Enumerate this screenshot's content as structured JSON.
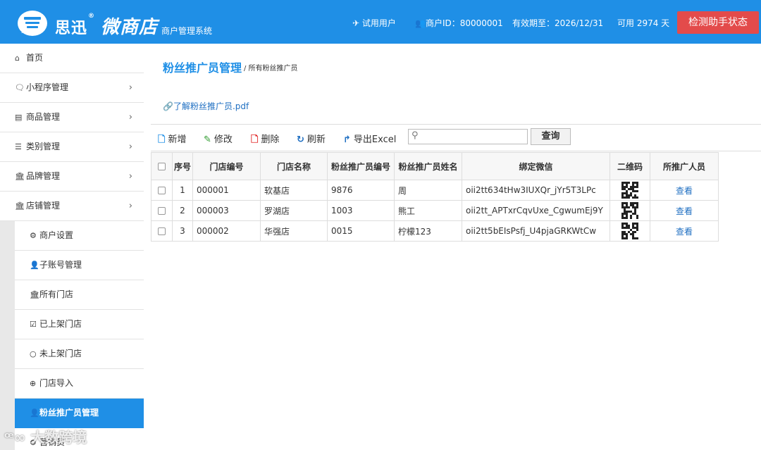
{
  "header": {
    "brand": "思迅",
    "brand_reg": "®",
    "brand2": "微商店",
    "subsystem": "商户管理系统",
    "user_type": "试用用户",
    "merchant_id": "商户ID：80000001",
    "expiry": "有效期至：2026/12/31",
    "available": "可用 2974 天",
    "detect_button": "检测助手状态",
    "accent": "#1f8fe6",
    "detect_color": "#e34b4b"
  },
  "sidebar": {
    "items": [
      {
        "label": "首页",
        "icon": "home-icon",
        "chevron": ""
      },
      {
        "label": "小程序管理",
        "icon": "chat-icon",
        "chevron": "›"
      },
      {
        "label": "商品管理",
        "icon": "card-icon",
        "chevron": "›"
      },
      {
        "label": "类别管理",
        "icon": "list-icon",
        "chevron": "›"
      },
      {
        "label": "品牌管理",
        "icon": "bank-icon",
        "chevron": "›"
      },
      {
        "label": "店铺管理",
        "icon": "bank-icon",
        "chevron": "›"
      }
    ],
    "sub_items": [
      {
        "label": "商户设置",
        "icon": "gear-icon"
      },
      {
        "label": "子账号管理",
        "icon": "user-icon"
      },
      {
        "label": "所有门店",
        "icon": "bank-icon"
      },
      {
        "label": "已上架门店",
        "icon": "check-square-icon"
      },
      {
        "label": "未上架门店",
        "icon": "circle-icon"
      },
      {
        "label": "门店导入",
        "icon": "plus-circle-icon"
      },
      {
        "label": "粉丝推广员管理",
        "icon": "user-icon"
      },
      {
        "label": "营销员",
        "icon": "gear-icon"
      }
    ]
  },
  "main": {
    "title": "粉丝推广员管理",
    "breadcrumb": "/ 所有粉丝推广员",
    "pdf_link": "了解粉丝推广员.pdf",
    "toolbar": {
      "add": "新增",
      "edit": "修改",
      "delete": "删除",
      "refresh": "刷新",
      "export": "导出Excel",
      "search_value": "",
      "query": "查询"
    },
    "table": {
      "headers": [
        "序号",
        "门店编号",
        "门店名称",
        "粉丝推广员编号",
        "粉丝推广员姓名",
        "绑定微信",
        "二维码",
        "所推广人员"
      ],
      "rows": [
        {
          "no": "1",
          "store_code": "000001",
          "store_name": "软基店",
          "promoter_code": "9876",
          "promoter_name": "周",
          "wechat": "oii2tt634tHw3IUXQr_jYr5T3LPc",
          "action": "查看"
        },
        {
          "no": "2",
          "store_code": "000003",
          "store_name": "罗湖店",
          "promoter_code": "1003",
          "promoter_name": "熊工",
          "wechat": "oii2tt_APTxrCqvUxe_CgwumEj9Y",
          "action": "查看"
        },
        {
          "no": "3",
          "store_code": "000002",
          "store_name": "华强店",
          "promoter_code": "0015",
          "promoter_name": "柠檬123",
          "wechat": "oii2tt5bEIsPsfj_U4pjaGRKWtCw",
          "action": "查看"
        }
      ]
    }
  },
  "watermark": "大数跨境"
}
